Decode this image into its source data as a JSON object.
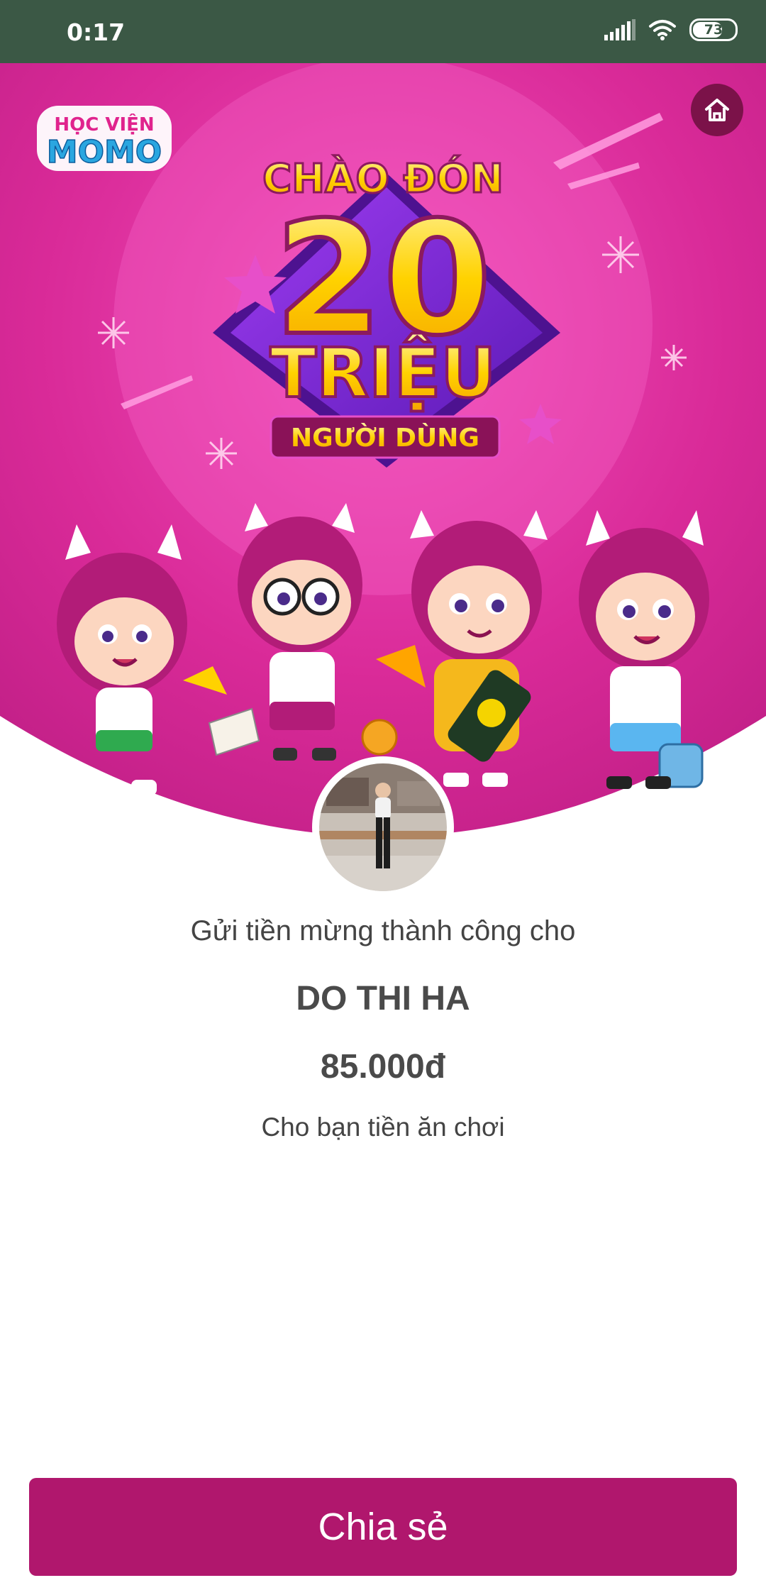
{
  "status_bar": {
    "time": "0:17",
    "battery": "73",
    "battery_level": 0.73
  },
  "banner": {
    "logo_line1": "HỌC VIỆN",
    "logo_line2": "MOMO",
    "headline_top": "CHÀO ĐÓN",
    "headline_number": "20",
    "headline_unit": "TRIỆU",
    "headline_bottom": "NGƯỜI DÙNG",
    "home_icon": "home-icon"
  },
  "result": {
    "title": "Gửi tiền mừng thành công cho",
    "recipient": "DO THI HA",
    "amount": "85.000đ",
    "note": "Cho bạn tiền ăn chơi"
  },
  "actions": {
    "share_label": "Chia sẻ"
  },
  "colors": {
    "status_bar": "#3b5845",
    "banner": "#d92a98",
    "accent": "#b0176d",
    "gold": "#ffd200"
  }
}
